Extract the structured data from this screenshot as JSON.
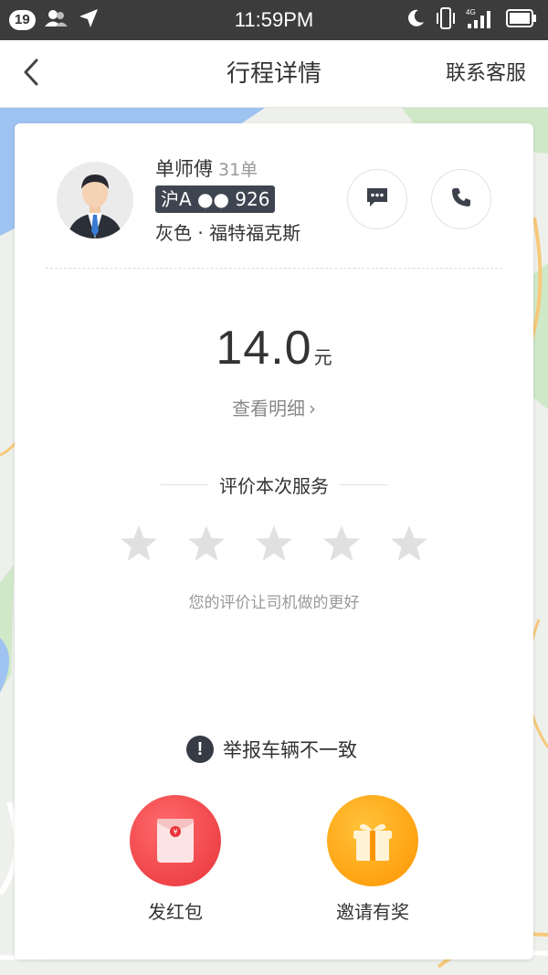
{
  "status_bar": {
    "notification_count": "19",
    "time": "11:59PM",
    "network": "4G"
  },
  "nav": {
    "title": "行程详情",
    "contact_label": "联系客服",
    "back_icon": "chevron-left-icon"
  },
  "driver": {
    "name": "单师傅",
    "orders": "31单",
    "plate": "沪A ●● 926",
    "car": "灰色 · 福特福克斯"
  },
  "fare": {
    "amount": "14.0",
    "unit": "元",
    "detail_label": "查看明细"
  },
  "rating": {
    "title": "评价本次服务",
    "hint": "您的评价让司机做的更好",
    "max_stars": 5,
    "selected": 0
  },
  "report": {
    "label": "举报车辆不一致"
  },
  "actions": {
    "red_packet_label": "发红包",
    "invite_label": "邀请有奖"
  },
  "colors": {
    "red": "#e8333a",
    "orange": "#ff9500",
    "dark": "#3f4550"
  }
}
